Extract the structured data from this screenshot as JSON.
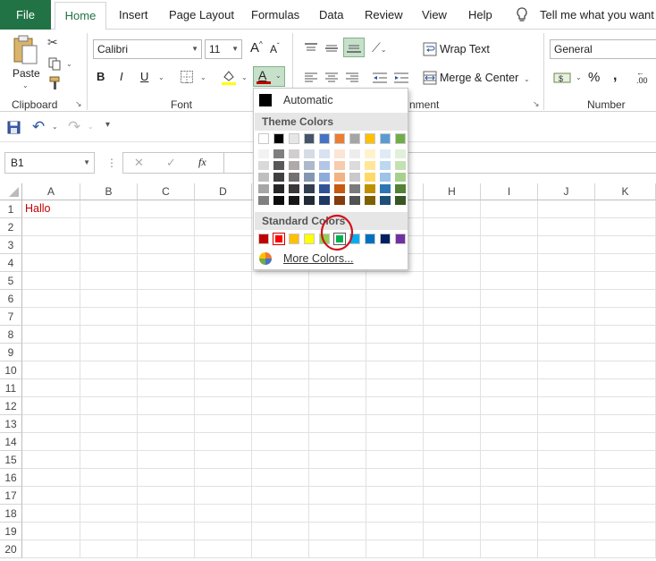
{
  "tabs": {
    "file": "File",
    "home": "Home",
    "insert": "Insert",
    "page_layout": "Page Layout",
    "formulas": "Formulas",
    "data": "Data",
    "review": "Review",
    "view": "View",
    "help": "Help",
    "tell_me": "Tell me what you want to"
  },
  "ribbon": {
    "clipboard": {
      "paste": "Paste",
      "label": "Clipboard"
    },
    "font": {
      "name": "Calibri",
      "size": "11",
      "bold": "B",
      "italic": "I",
      "underline": "U",
      "label": "Font",
      "grow": "A",
      "shrink": "A",
      "color_letter": "A"
    },
    "alignment": {
      "wrap_text": "Wrap Text",
      "merge_center": "Merge & Center",
      "label_partial": "nment"
    },
    "number": {
      "format": "General",
      "currency": "$",
      "percent": "%",
      "comma": ",",
      "label": "Number",
      "inc_decimal": ".00"
    }
  },
  "formula_bar": {
    "name_box": "B1",
    "fx": "fx",
    "cancel": "✕",
    "enter": "✓"
  },
  "grid": {
    "columns": [
      "A",
      "B",
      "C",
      "D",
      "E",
      "F",
      "G",
      "H",
      "I",
      "J",
      "K"
    ],
    "rows": [
      "1",
      "2",
      "3",
      "4",
      "5",
      "6",
      "7",
      "8",
      "9",
      "10",
      "11",
      "12",
      "13",
      "14",
      "15",
      "16",
      "17",
      "18",
      "19",
      "20"
    ],
    "a1_value": "Hallo",
    "a1_color": "#C00000"
  },
  "color_menu": {
    "automatic": "Automatic",
    "theme_header": "Theme Colors",
    "standard_header": "Standard Colors",
    "more_colors": "More Colors...",
    "theme_top": [
      "#FFFFFF",
      "#000000",
      "#E7E6E6",
      "#44546A",
      "#4472C4",
      "#ED7D31",
      "#A5A5A5",
      "#FFC000",
      "#5B9BD5",
      "#70AD47"
    ],
    "theme_shades": [
      [
        "#F2F2F2",
        "#D9D9D9",
        "#BFBFBF",
        "#A6A6A6",
        "#808080"
      ],
      [
        "#7F7F7F",
        "#595959",
        "#404040",
        "#262626",
        "#0D0D0D"
      ],
      [
        "#D0CECE",
        "#AEAAAA",
        "#757171",
        "#3A3838",
        "#171616"
      ],
      [
        "#D6DCE4",
        "#ADB9CA",
        "#8497B0",
        "#333F4F",
        "#222A35"
      ],
      [
        "#D9E2F3",
        "#B4C6E7",
        "#8EAADB",
        "#2F5496",
        "#1F3864"
      ],
      [
        "#FBE5D5",
        "#F8CBAD",
        "#F4B183",
        "#C55A11",
        "#833C0B"
      ],
      [
        "#EDEDED",
        "#DBDBDB",
        "#C9C9C9",
        "#7B7B7B",
        "#525252"
      ],
      [
        "#FFF2CC",
        "#FFE699",
        "#FFD966",
        "#BF9000",
        "#7F6000"
      ],
      [
        "#DEEBF6",
        "#BDD7EE",
        "#9DC3E6",
        "#2E75B5",
        "#1F4E79"
      ],
      [
        "#E2EFD9",
        "#C5E0B3",
        "#A8D08D",
        "#538135",
        "#375623"
      ]
    ],
    "standard": [
      "#C00000",
      "#FF0000",
      "#FFC000",
      "#FFFF00",
      "#92D050",
      "#00B050",
      "#00B0F0",
      "#0070C0",
      "#002060",
      "#7030A0"
    ],
    "selected_standard_index": 1,
    "highlighted_standard_index": 5,
    "annotation_color": "#D0121B",
    "font_color_bar": "#C00000"
  }
}
